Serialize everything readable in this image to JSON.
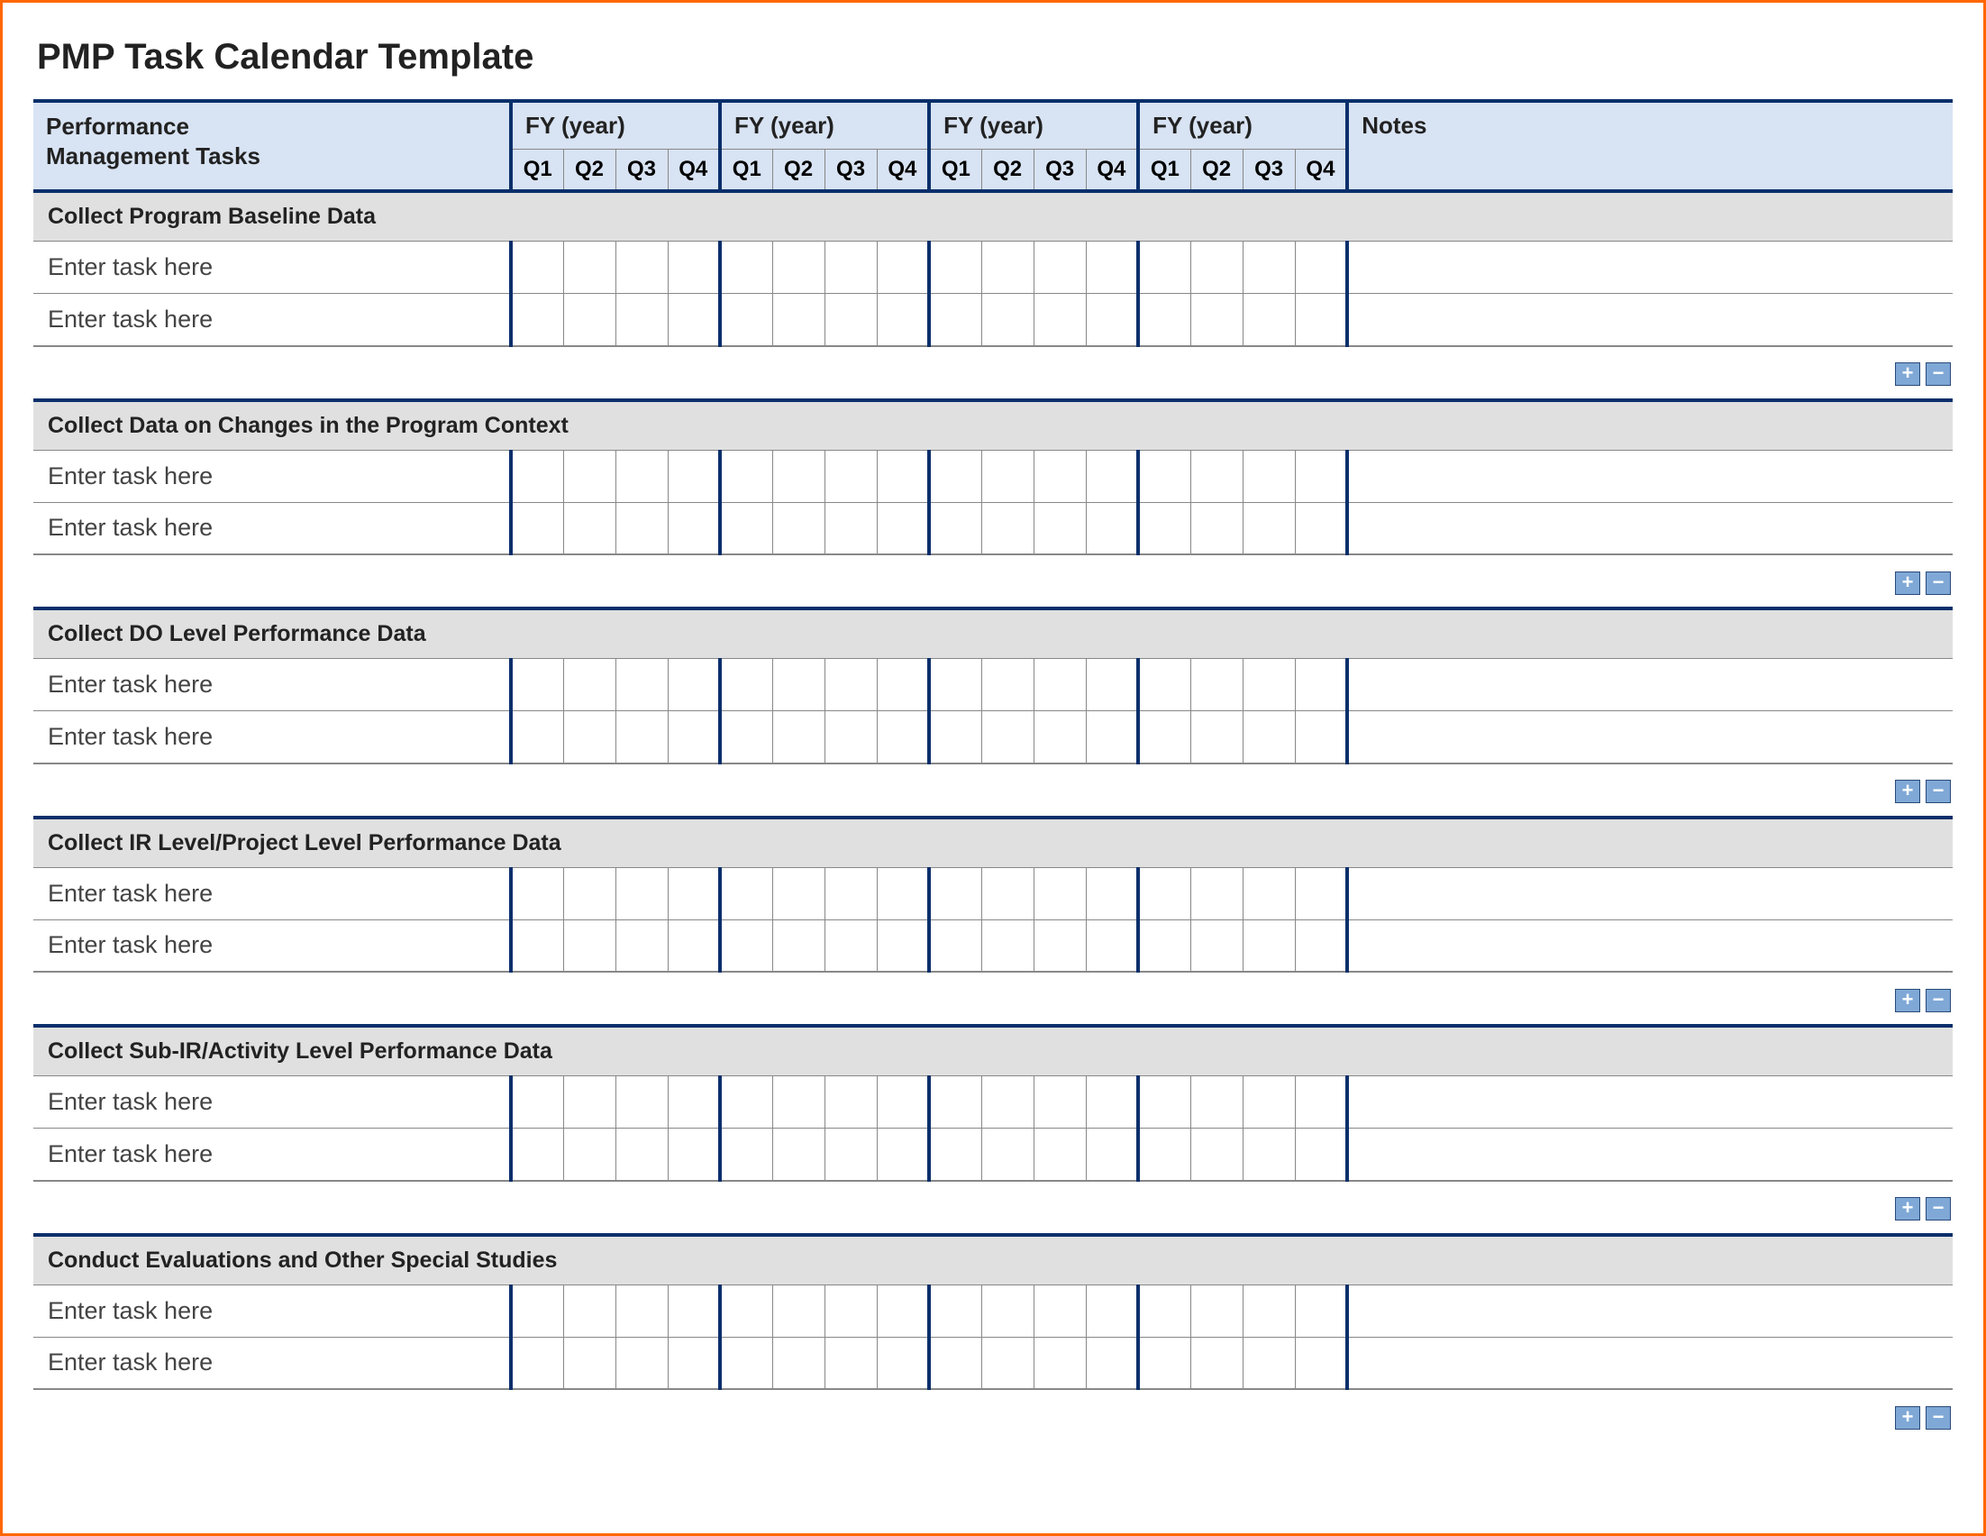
{
  "title": "PMP Task Calendar Template",
  "header": {
    "tasks_label": "Performance\nManagement Tasks",
    "fy_label": "FY  (year)",
    "quarters": [
      "Q1",
      "Q2",
      "Q3",
      "Q4"
    ],
    "notes_label": "Notes"
  },
  "sections": [
    {
      "name": "Collect Program Baseline Data",
      "rows": [
        "Enter task here",
        "Enter task here"
      ]
    },
    {
      "name": "Collect Data on Changes in the Program Context",
      "rows": [
        "Enter task here",
        "Enter task here"
      ]
    },
    {
      "name": "Collect DO Level Performance Data",
      "rows": [
        "Enter task here",
        "Enter task here"
      ]
    },
    {
      "name": "Collect IR Level/Project Level Performance Data",
      "rows": [
        "Enter task here",
        "Enter task here"
      ]
    },
    {
      "name": "Collect Sub-IR/Activity Level Performance Data",
      "rows": [
        "Enter task here",
        "Enter task here"
      ]
    },
    {
      "name": "Conduct Evaluations and Other Special Studies",
      "rows": [
        "Enter task here",
        "Enter task here"
      ]
    }
  ],
  "controls": {
    "add": "+",
    "remove": "−"
  }
}
